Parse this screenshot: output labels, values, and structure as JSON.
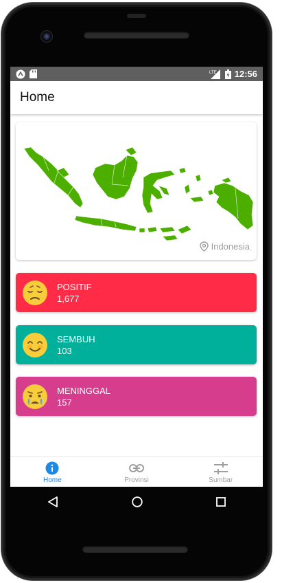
{
  "status_bar": {
    "time": "12:56",
    "network": "LTE"
  },
  "app_bar": {
    "title": "Home"
  },
  "map": {
    "location_label": "Indonesia",
    "color": "#4caf00"
  },
  "stats": [
    {
      "label": "POSITIF",
      "value": "1,677",
      "color": "#ff2b47",
      "icon": "sad-face-icon"
    },
    {
      "label": "SEMBUH",
      "value": "103",
      "color": "#00b09b",
      "icon": "smiling-face-icon"
    },
    {
      "label": "MENINGGAL",
      "value": "157",
      "color": "#d63e8d",
      "icon": "crying-face-icon"
    }
  ],
  "bottom_nav": [
    {
      "label": "Home",
      "icon": "info-icon",
      "active": true
    },
    {
      "label": "Provinsi",
      "icon": "link-icon",
      "active": false
    },
    {
      "label": "Sumbar",
      "icon": "sliders-icon",
      "active": false
    }
  ],
  "colors": {
    "accent": "#1e88e5",
    "status_bar": "#5f5f5f"
  }
}
